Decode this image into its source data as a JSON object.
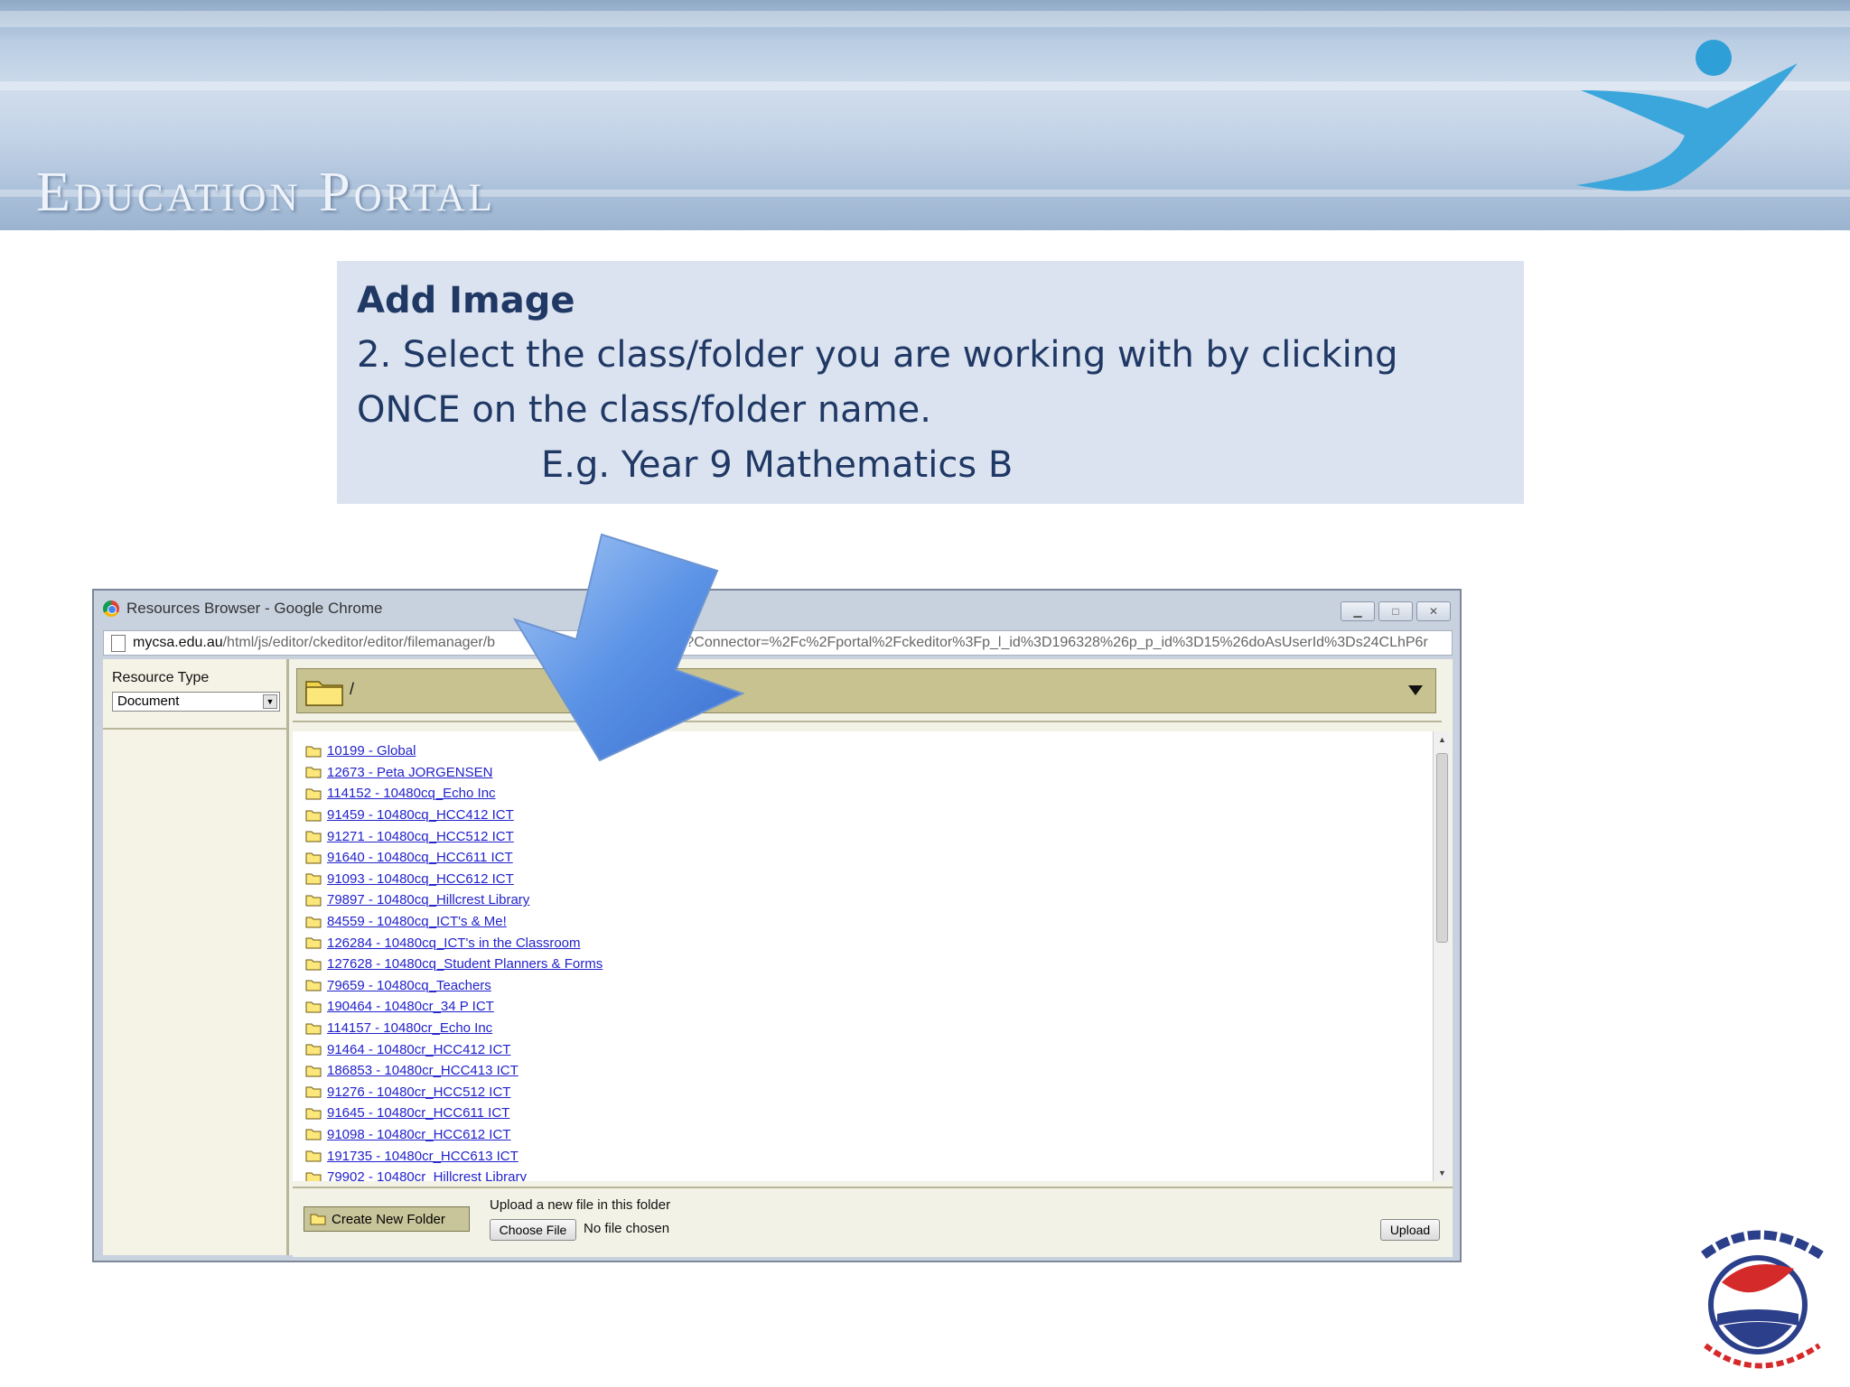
{
  "banner": {
    "title": "Education Portal"
  },
  "instruction": {
    "heading": "Add Image",
    "line1": "2. Select the class/folder you are working with by clicking",
    "line2": "ONCE on the class/folder name.",
    "example": "E.g. Year 9 Mathematics B"
  },
  "window": {
    "title": "Resources Browser - Google Chrome",
    "url_domain": "mycsa.edu.au",
    "url_path": "/html/js/editor/ckeditor/editor/filemanager/b",
    "url_tail": "tml?Connector=%2Fc%2Fportal%2Fckeditor%3Fp_l_id%3D196328%26p_p_id%3D15%26doAsUserId%3Ds24CLhP6r"
  },
  "resource_type": {
    "label": "Resource Type",
    "value": "Document"
  },
  "current_path": "/",
  "folders": [
    "10199 - Global",
    "12673 - Peta JORGENSEN",
    "114152 - 10480cq_Echo Inc",
    "91459 - 10480cq_HCC412 ICT",
    "91271 - 10480cq_HCC512 ICT",
    "91640 - 10480cq_HCC611 ICT",
    "91093 - 10480cq_HCC612 ICT",
    "79897 - 10480cq_Hillcrest Library",
    "84559 - 10480cq_ICT's & Me!",
    "126284 - 10480cq_ICT's in the Classroom",
    "127628 - 10480cq_Student Planners & Forms",
    "79659 - 10480cq_Teachers",
    "190464 - 10480cr_34 P ICT",
    "114157 - 10480cr_Echo Inc",
    "91464 - 10480cr_HCC412 ICT",
    "186853 - 10480cr_HCC413 ICT",
    "91276 - 10480cr_HCC512 ICT",
    "91645 - 10480cr_HCC611 ICT",
    "91098 - 10480cr_HCC612 ICT",
    "191735 - 10480cr_HCC613 ICT",
    "79902 - 10480cr_Hillcrest Library"
  ],
  "bottom": {
    "create_folder": "Create New Folder",
    "upload_label": "Upload a new file in this folder",
    "choose_file": "Choose File",
    "no_file": "No file chosen",
    "upload": "Upload"
  },
  "colors": {
    "instruction_bg": "#dbe3f0",
    "instruction_text": "#1f3864",
    "link": "#2222cc",
    "path_bar": "#c7c290"
  }
}
